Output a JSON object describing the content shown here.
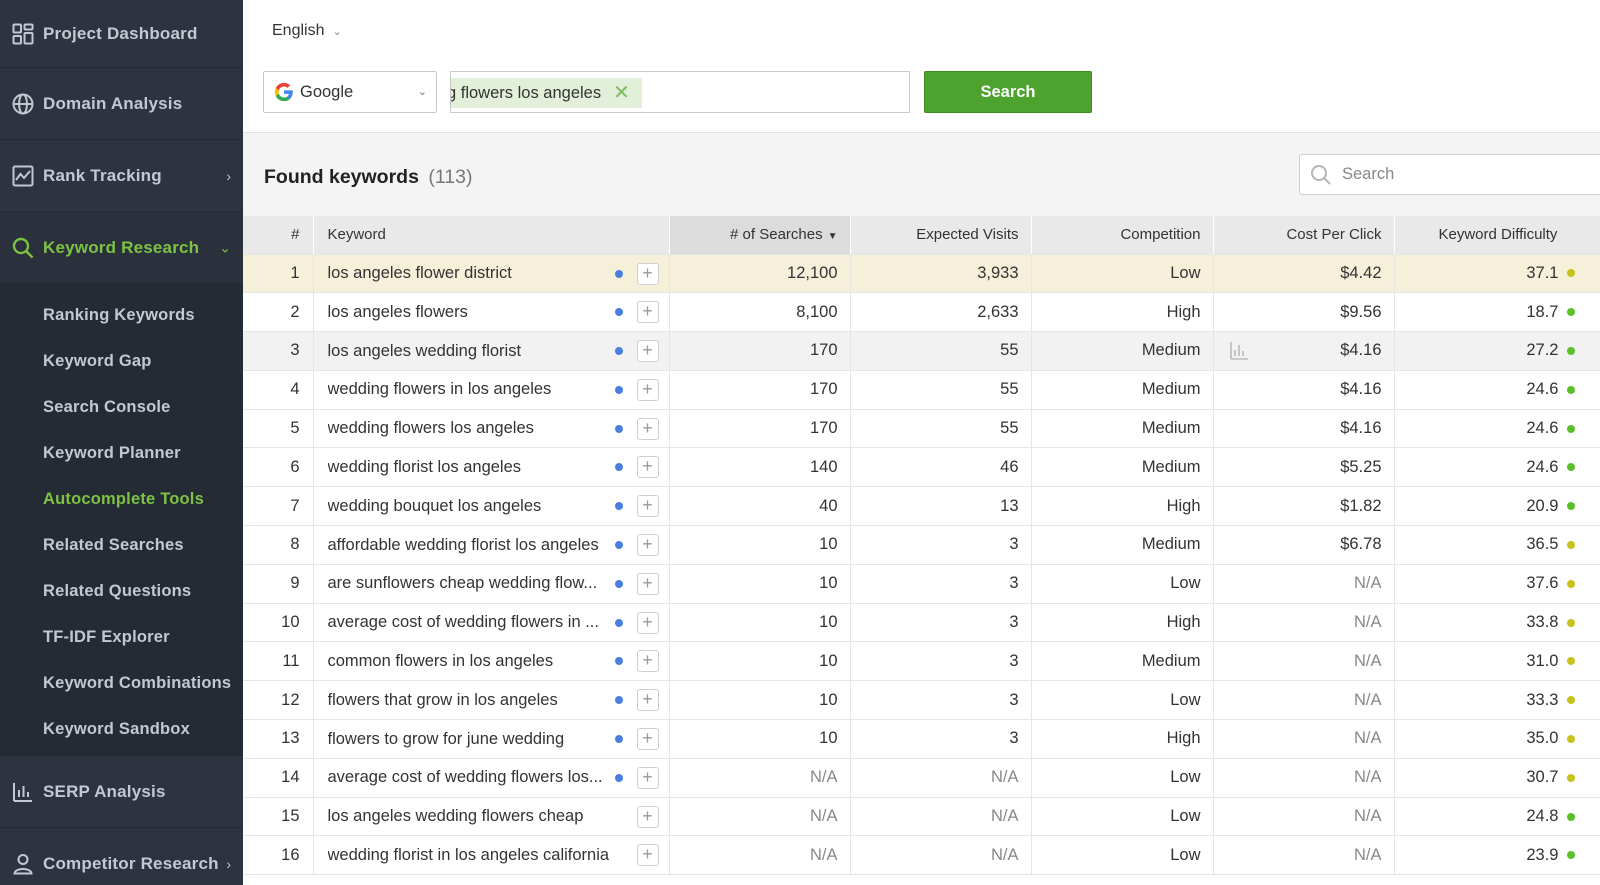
{
  "sidebar": {
    "groups": [
      {
        "label": "Project Dashboard",
        "icon": "dashboard-icon"
      },
      {
        "label": "Domain Analysis",
        "icon": "globe-icon"
      },
      {
        "label": "Rank Tracking",
        "icon": "line-chart-icon"
      },
      {
        "label": "Keyword Research",
        "icon": "search-icon"
      },
      {
        "label": "SERP Analysis",
        "icon": "bar-chart-icon"
      },
      {
        "label": "Competitor Research",
        "icon": "user-icon"
      }
    ],
    "submenu": [
      "Ranking Keywords",
      "Keyword Gap",
      "Search Console",
      "Keyword Planner",
      "Autocomplete Tools",
      "Related Searches",
      "Related Questions",
      "TF-IDF Explorer",
      "Keyword Combinations",
      "Keyword Sandbox"
    ],
    "selected_submenu": "Autocomplete Tools",
    "accent_color": "#7dc242"
  },
  "toolbar": {
    "language": "English",
    "engine": "Google",
    "keyword_tag": "g flowers los angeles",
    "search_label": "Search"
  },
  "results": {
    "title": "Found keywords",
    "count": "(113)",
    "filter_placeholder": "Search"
  },
  "table": {
    "columns": {
      "num": "#",
      "keyword": "Keyword",
      "searches": "# of Searches",
      "visits": "Expected Visits",
      "competition": "Competition",
      "cpc": "Cost Per Click",
      "difficulty": "Keyword Difficulty"
    },
    "rows": [
      {
        "num": "1",
        "keyword": "los angeles flower district",
        "searches": "12,100",
        "visits": "3,933",
        "competition": "Low",
        "cpc": "$4.42",
        "kd": "37.1",
        "kd_color": "#c7c21c",
        "dot": true
      },
      {
        "num": "2",
        "keyword": "los angeles flowers",
        "searches": "8,100",
        "visits": "2,633",
        "competition": "High",
        "cpc": "$9.56",
        "kd": "18.7",
        "kd_color": "#5cbf2a",
        "dot": true
      },
      {
        "num": "3",
        "keyword": "los angeles wedding florist",
        "searches": "170",
        "visits": "55",
        "competition": "Medium",
        "cpc": "$4.16",
        "kd": "27.2",
        "kd_color": "#5cbf2a",
        "dot": true
      },
      {
        "num": "4",
        "keyword": "wedding flowers in los angeles",
        "searches": "170",
        "visits": "55",
        "competition": "Medium",
        "cpc": "$4.16",
        "kd": "24.6",
        "kd_color": "#5cbf2a",
        "dot": true
      },
      {
        "num": "5",
        "keyword": "wedding flowers los angeles",
        "searches": "170",
        "visits": "55",
        "competition": "Medium",
        "cpc": "$4.16",
        "kd": "24.6",
        "kd_color": "#5cbf2a",
        "dot": true
      },
      {
        "num": "6",
        "keyword": "wedding florist los angeles",
        "searches": "140",
        "visits": "46",
        "competition": "Medium",
        "cpc": "$5.25",
        "kd": "24.6",
        "kd_color": "#5cbf2a",
        "dot": true
      },
      {
        "num": "7",
        "keyword": "wedding bouquet los angeles",
        "searches": "40",
        "visits": "13",
        "competition": "High",
        "cpc": "$1.82",
        "kd": "20.9",
        "kd_color": "#5cbf2a",
        "dot": true
      },
      {
        "num": "8",
        "keyword": "affordable wedding florist los angeles",
        "searches": "10",
        "visits": "3",
        "competition": "Medium",
        "cpc": "$6.78",
        "kd": "36.5",
        "kd_color": "#c7c21c",
        "dot": true
      },
      {
        "num": "9",
        "keyword": "are sunflowers cheap wedding flow...",
        "searches": "10",
        "visits": "3",
        "competition": "Low",
        "cpc": "N/A",
        "kd": "37.6",
        "kd_color": "#c7c21c",
        "dot": true
      },
      {
        "num": "10",
        "keyword": "average cost of wedding flowers in ...",
        "searches": "10",
        "visits": "3",
        "competition": "High",
        "cpc": "N/A",
        "kd": "33.8",
        "kd_color": "#c7c21c",
        "dot": true
      },
      {
        "num": "11",
        "keyword": "common flowers in los angeles",
        "searches": "10",
        "visits": "3",
        "competition": "Medium",
        "cpc": "N/A",
        "kd": "31.0",
        "kd_color": "#c7c21c",
        "dot": true
      },
      {
        "num": "12",
        "keyword": "flowers that grow in los angeles",
        "searches": "10",
        "visits": "3",
        "competition": "Low",
        "cpc": "N/A",
        "kd": "33.3",
        "kd_color": "#c7c21c",
        "dot": true
      },
      {
        "num": "13",
        "keyword": "flowers to grow for june wedding",
        "searches": "10",
        "visits": "3",
        "competition": "High",
        "cpc": "N/A",
        "kd": "35.0",
        "kd_color": "#c7c21c",
        "dot": true
      },
      {
        "num": "14",
        "keyword": "average cost of wedding flowers los...",
        "searches": "N/A",
        "visits": "N/A",
        "competition": "Low",
        "cpc": "N/A",
        "kd": "30.7",
        "kd_color": "#c7c21c",
        "dot": true
      },
      {
        "num": "15",
        "keyword": "los angeles wedding flowers cheap",
        "searches": "N/A",
        "visits": "N/A",
        "competition": "Low",
        "cpc": "N/A",
        "kd": "24.8",
        "kd_color": "#5cbf2a",
        "dot": false
      },
      {
        "num": "16",
        "keyword": "wedding florist in los angeles california",
        "searches": "N/A",
        "visits": "N/A",
        "competition": "Low",
        "cpc": "N/A",
        "kd": "23.9",
        "kd_color": "#5cbf2a",
        "dot": false
      }
    ]
  }
}
